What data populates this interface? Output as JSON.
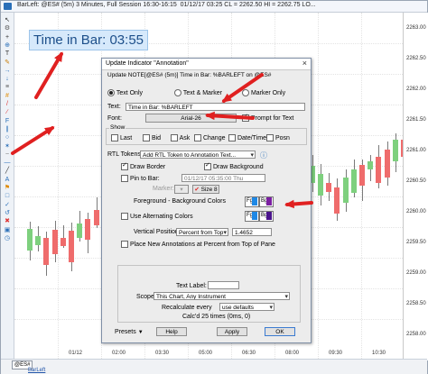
{
  "window": {
    "title": "BarLeft: @ES# (5m) 3 Minutes, Full Session 16:30-16:15",
    "quote": "01/12/17 03:25 CL = 2262.50 HI = 2262.75 LO..."
  },
  "annotation": {
    "text": "Time in Bar: 03:55"
  },
  "price_axis": {
    "labels": [
      "2263.00",
      "2262.50",
      "2262.00",
      "2261.50",
      "2261.00",
      "2260.50",
      "2260.00",
      "2259.50",
      "2259.00",
      "2258.50",
      "2258.00"
    ]
  },
  "time_axis": {
    "labels": [
      "01/12",
      "02:00",
      "03:30",
      "05:00",
      "06:30",
      "08:00",
      "09:30",
      "10:30"
    ]
  },
  "status_bar": {
    "symbol": "@ES#",
    "tab": "BarLeft"
  },
  "dialog": {
    "title": "Update Indicator \"Annotation\"",
    "subtitle": "Update NOTE[@ES# (5m)] Time in Bar: %BARLEFT  on @ES#",
    "radios": [
      {
        "label": "Text Only",
        "selected": true
      },
      {
        "label": "Text & Marker",
        "selected": false
      },
      {
        "label": "Marker Only",
        "selected": false
      }
    ],
    "text_label": "Text:",
    "text_value": "Time in Bar: %BARLEFT",
    "font_label": "Font:",
    "font_value": "Arial-26",
    "prompt_label": "Prompt for Text",
    "show_label": "Show",
    "show_items": [
      "Last",
      "Bid",
      "Ask",
      "Change",
      "Date/Time",
      "Posn"
    ],
    "rtl_label": "RTL Tokens:",
    "rtl_value": "Add RTL Token to Annotation Text...",
    "draw_border": "Draw Border",
    "draw_background": "Draw Background",
    "pin_to_bar": "Pin to Bar:",
    "pin_value": "01/12/17 05:35:00 Thu",
    "marker_label": "Marker:",
    "size_label": "Size 8",
    "fg_bg_label": "Foreground - Background Colors",
    "fg": "Fg",
    "bg": "Bg",
    "alt_colors": "Use Alternating Colors",
    "vpos_label": "Vertical Position:",
    "vpos_value": "Percent from Top",
    "vpos_number": "1.4652",
    "place_new": "Place New Annotations at Percent from Top of Pane",
    "text_label_field": "Text Label:",
    "scope_label": "Scope:",
    "scope_value": "This Chart, Any Instrument",
    "recalc_label": "Recalculate every",
    "recalc_value": "use defaults",
    "calc_info": "Calc'd 25 times (0ms, 0)",
    "presets": "Presets",
    "help": "Help",
    "apply": "Apply",
    "ok": "OK"
  },
  "colors": {
    "fg_swatch": "#1e88e5",
    "bg_swatch": "#7b1fa2",
    "bg_swatch2": "#4a148c",
    "arrow": "#e02020",
    "bull": "#7ed07e",
    "bear": "#ef6c6c",
    "annotation_fill": "#d6e9fb"
  }
}
